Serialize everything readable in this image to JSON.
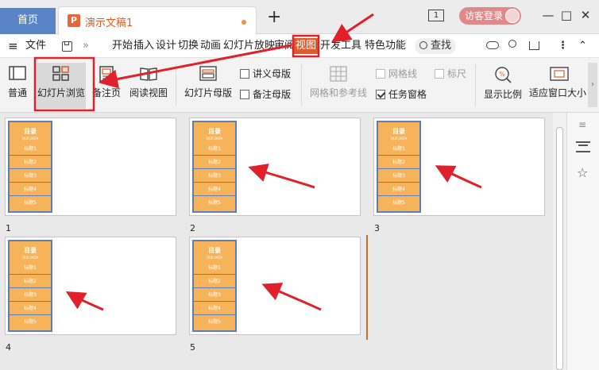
{
  "titlebar": {
    "home_tab": "首页",
    "doc_icon_letter": "P",
    "doc_title": "演示文稿1",
    "new_tab": "+",
    "window_count": "1",
    "visitor_login": "访客登录",
    "minimize": "—",
    "restore": "□",
    "close": "✕"
  },
  "menubar": {
    "menu_icon": "≡",
    "file": "文件",
    "more_chevron": "»",
    "items": [
      "开始",
      "插入",
      "设计",
      "切换",
      "动画",
      "幻灯片放映",
      "审阅",
      "视图",
      "开发工具",
      "特色功能"
    ],
    "search": "查找",
    "selected": "视图"
  },
  "ribbon": {
    "normal": "普通",
    "slide_sorter": "幻灯片浏览",
    "notes_page": "备注页",
    "reading_view": "阅读视图",
    "slide_master": "幻灯片母版",
    "handout_master": "讲义母版",
    "notes_master": "备注母版",
    "grid_guides": "网格和参考线",
    "gridlines": "网格线",
    "ruler": "标尺",
    "task_pane": "任务窗格",
    "task_pane_checked": true,
    "zoom": "显示比例",
    "fit_window": "适应窗口大小"
  },
  "slide_panel": {
    "title": "目录",
    "subtitle": "OUR DATA",
    "items": [
      "标题1",
      "标题2",
      "标题3",
      "标题4",
      "标题5"
    ]
  },
  "slides": [
    {
      "number": "1"
    },
    {
      "number": "2"
    },
    {
      "number": "3"
    },
    {
      "number": "4"
    },
    {
      "number": "5"
    }
  ],
  "colors": {
    "accent_orange": "#e05a2a",
    "annotation_red": "#e0202a",
    "home_tab_blue": "#5b84c6",
    "panel_orange": "#f6b35a",
    "panel_border": "#5b7fb6"
  }
}
